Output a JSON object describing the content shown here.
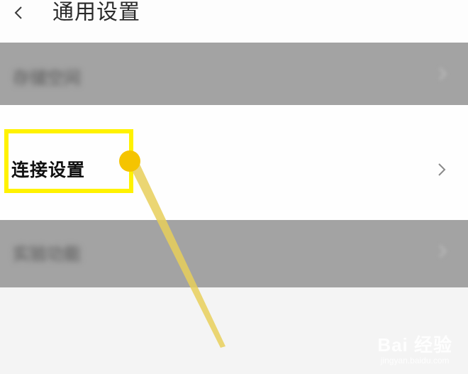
{
  "header": {
    "back_icon": "chevron-left-icon",
    "title": "通用设置"
  },
  "rows": [
    {
      "label": "存储空间",
      "blurred": true,
      "chevron_icon": "chevron-right-icon"
    },
    {
      "label": "连接设置",
      "blurred": false,
      "chevron_icon": "chevron-right-icon"
    },
    {
      "label": "实验功能",
      "blurred": true,
      "chevron_icon": "chevron-right-icon"
    }
  ],
  "annotation": {
    "highlight_color": "#fff200",
    "pointer_color": "#f5c400",
    "line_color": "#e8cf5a"
  },
  "watermark": {
    "main": "Bai 经验",
    "sub": "jingyan.baidu.com"
  },
  "colors": {
    "header_bg": "#fdfdfd",
    "blurred_row_bg": "#a3a3a3",
    "active_row_bg": "#fefefe",
    "page_bg": "#f4f4f4"
  }
}
